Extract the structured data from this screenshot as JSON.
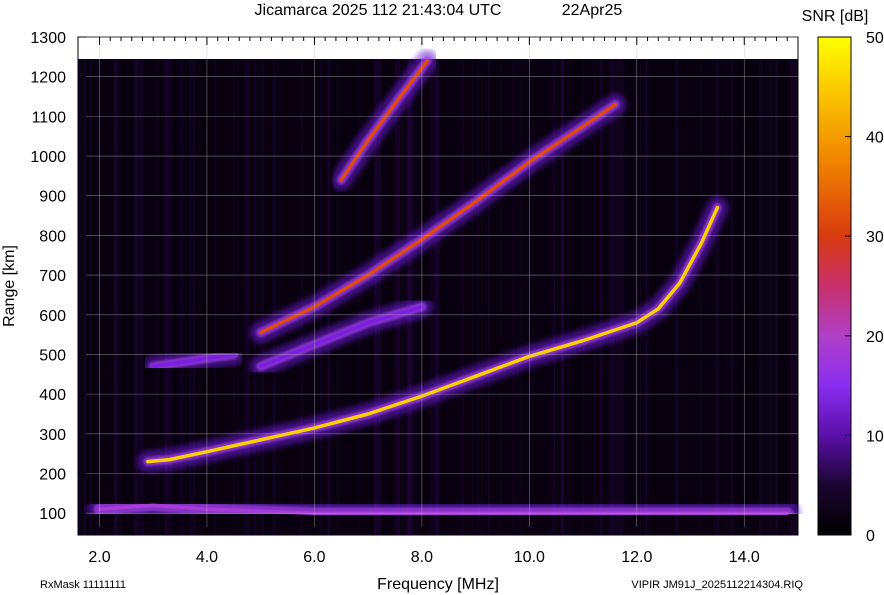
{
  "chart_data": {
    "type": "heatmap",
    "title": "Jicamarca 2025 112 21:43:04 UTC",
    "date_label": "22Apr25",
    "xlabel": "Frequency [MHz]",
    "ylabel": "Range [km]",
    "xlim": [
      1.6,
      15.0
    ],
    "ylim": [
      45,
      1300
    ],
    "xticks": [
      2.0,
      4.0,
      6.0,
      8.0,
      10.0,
      12.0,
      14.0
    ],
    "xtick_labels": [
      "2.0",
      "4.0",
      "6.0",
      "8.0",
      "10.0",
      "12.0",
      "14.0"
    ],
    "yticks": [
      100,
      200,
      300,
      400,
      500,
      600,
      700,
      800,
      900,
      1000,
      1100,
      1200,
      1300
    ],
    "ytick_labels": [
      "100",
      "200",
      "300",
      "400",
      "500",
      "600",
      "700",
      "800",
      "900",
      "1000",
      "1100",
      "1200",
      "1300"
    ],
    "grid": true,
    "colorbar": {
      "label": "SNR [dB]",
      "range": [
        0,
        50
      ],
      "ticks": [
        0,
        10,
        20,
        30,
        40,
        50
      ],
      "tick_labels": [
        "0",
        "10",
        "20",
        "30",
        "40",
        "50"
      ],
      "colors": [
        "#000000",
        "#3a0a6a",
        "#7a1ee6",
        "#a83cd8",
        "#c8286e",
        "#e04a10",
        "#f08a00",
        "#fbd200",
        "#ffff00"
      ]
    },
    "traces": [
      {
        "name": "",
        "points": [
          [
            2.9,
            230
          ],
          [
            3.3,
            235
          ],
          [
            4.0,
            255
          ],
          [
            5.0,
            285
          ],
          [
            6.0,
            315
          ],
          [
            7.0,
            350
          ],
          [
            8.0,
            395
          ],
          [
            9.0,
            445
          ],
          [
            10.0,
            495
          ],
          [
            11.0,
            535
          ],
          [
            12.0,
            580
          ],
          [
            12.4,
            615
          ],
          [
            12.8,
            680
          ],
          [
            13.2,
            780
          ],
          [
            13.5,
            870
          ]
        ],
        "snr": 44
      },
      {
        "name": "",
        "points": [
          [
            5.0,
            555
          ],
          [
            6.0,
            620
          ],
          [
            7.0,
            700
          ],
          [
            8.0,
            790
          ],
          [
            9.0,
            885
          ],
          [
            10.0,
            985
          ],
          [
            11.0,
            1075
          ],
          [
            11.6,
            1130
          ]
        ],
        "snr": 32
      },
      {
        "name": "",
        "points": [
          [
            6.5,
            940
          ],
          [
            7.0,
            1040
          ],
          [
            7.6,
            1150
          ],
          [
            8.1,
            1240
          ]
        ],
        "snr": 30
      },
      {
        "name": "",
        "points": [
          [
            3.0,
            470
          ],
          [
            4.0,
            490
          ],
          [
            4.5,
            500
          ]
        ],
        "snr": 14
      },
      {
        "name": "",
        "points": [
          [
            5.0,
            470
          ],
          [
            6.0,
            525
          ],
          [
            7.0,
            580
          ],
          [
            8.0,
            620
          ]
        ],
        "snr": 12
      },
      {
        "name": "",
        "points": [
          [
            2.0,
            110
          ],
          [
            3.0,
            120
          ],
          [
            4.0,
            110
          ],
          [
            6.0,
            100
          ],
          [
            8.0,
            100
          ],
          [
            10.0,
            100
          ],
          [
            12.0,
            100
          ],
          [
            14.8,
            100
          ]
        ],
        "snr": 20
      }
    ]
  },
  "footer": {
    "rxmask": "RxMask 11111111",
    "file": "VIPIR  JM91J_2025112214304.RIQ"
  }
}
